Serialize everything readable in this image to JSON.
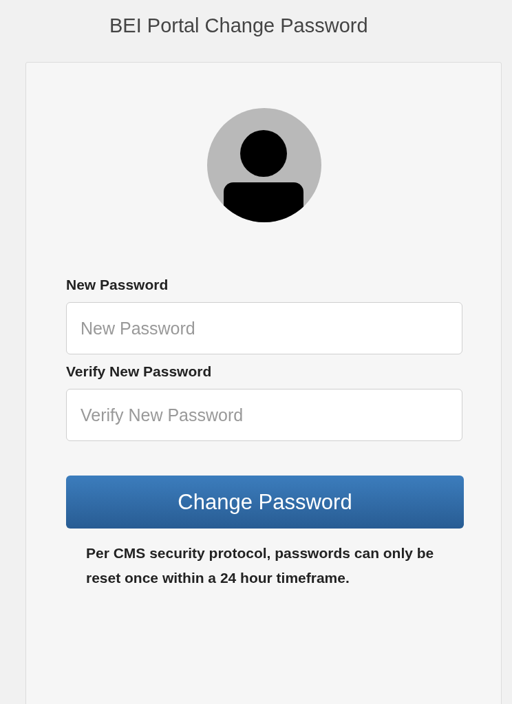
{
  "page_title": "BEI Portal Change Password",
  "fields": [
    {
      "label": "New Password",
      "placeholder": "New Password"
    },
    {
      "label": "Verify New Password",
      "placeholder": "Verify New Password"
    }
  ],
  "submit_button": "Change Password",
  "note": "Per CMS security protocol, passwords can only be reset once within a 24 hour timeframe."
}
